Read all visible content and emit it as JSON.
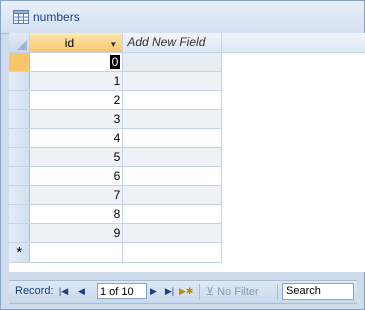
{
  "window": {
    "title": "numbers",
    "title_icon": "table-icon"
  },
  "grid": {
    "columns": [
      {
        "label": "id",
        "has_dropdown": true
      },
      {
        "label": "Add New Field"
      }
    ],
    "rows": [
      "0",
      "1",
      "2",
      "3",
      "4",
      "5",
      "6",
      "7",
      "8",
      "9"
    ],
    "current_row": 0,
    "new_row_marker": "*"
  },
  "statusbar": {
    "record_label": "Record:",
    "record_position": "1 of 10",
    "filter_label": "No Filter",
    "search_placeholder": "Search",
    "nav_icons": [
      "first-record-icon",
      "previous-record-icon",
      "next-record-icon",
      "last-record-icon",
      "new-record-icon"
    ]
  },
  "colors": {
    "selected_header": "#f8c56b",
    "alt_row": "#eef1f6",
    "grid_line": "#c5d3e6",
    "chrome_text": "#15428b"
  }
}
